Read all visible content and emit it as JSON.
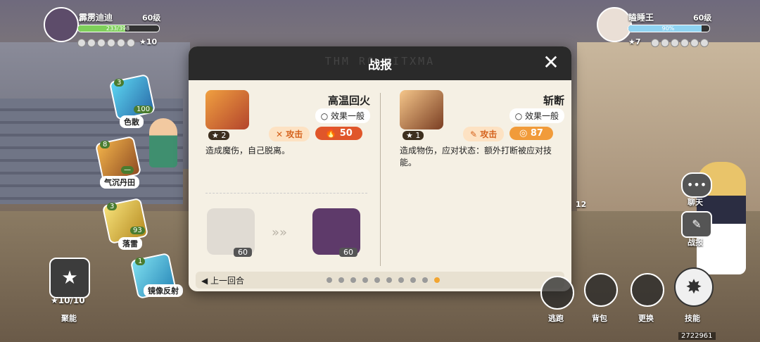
{
  "player": {
    "name": "霹雳迪迪",
    "level": "60级",
    "hp": "233/398",
    "hp_fraction": 0.585,
    "coins": "10"
  },
  "opponent": {
    "name": "瞌睡王",
    "level": "60级",
    "hp": "90%",
    "hp_fraction": 0.9,
    "coins": "7"
  },
  "skills_left": [
    {
      "name": "色散",
      "star": "3",
      "count": "100"
    },
    {
      "name": "气沉丹田",
      "star": "8",
      "count": "—"
    },
    {
      "name": "落雷",
      "star": "3",
      "count": "93"
    },
    {
      "name": "镜像反射",
      "star": "1",
      "count": "—"
    }
  ],
  "deck": {
    "count": "10/10",
    "label": "聚能"
  },
  "modal": {
    "title": "战报",
    "watermark": "THM RO KITXMA",
    "left": {
      "name": "高温回火",
      "effect": "效果一般",
      "star": "2",
      "type": "攻击",
      "cost": "50",
      "desc": "造成魔伤，自己脱离。",
      "from_level": "60",
      "to_level": "60"
    },
    "right": {
      "name": "斩断",
      "effect": "效果一般",
      "star": "1",
      "type": "攻击",
      "cost": "87",
      "desc": "造成物伤，应对状态：额外打断被应对技能。"
    },
    "prev_label": "上一回合",
    "page_total": 10,
    "page_current": 10
  },
  "right_controls": {
    "chat": "聊天",
    "report": "战报"
  },
  "bottom_buttons": [
    "逃跑",
    "背包",
    "更换",
    "技能"
  ],
  "side_count": "12",
  "build_id": "2722961",
  "colors": {
    "accent": "#f2a531",
    "cost": "#e0562a",
    "hp": "#7ecf5a"
  }
}
